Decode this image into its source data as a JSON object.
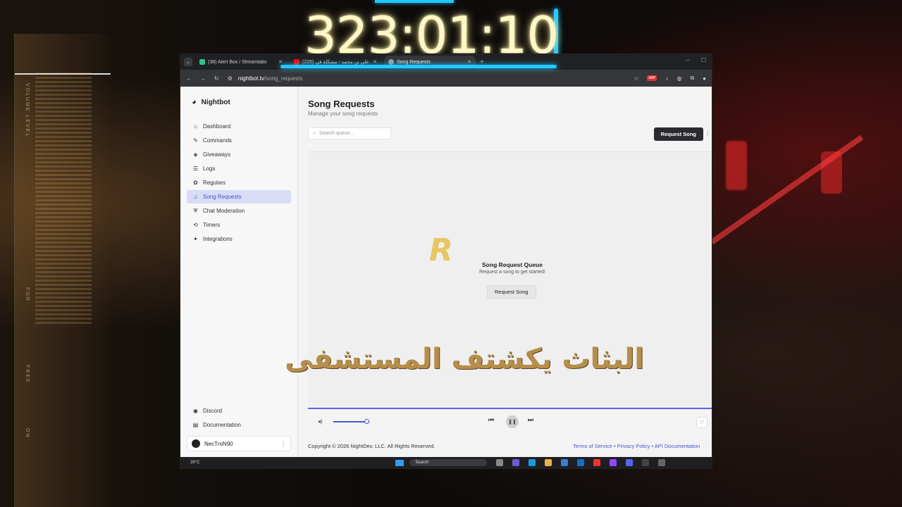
{
  "stream_overlay": {
    "timer": "323:01:10",
    "caption": "البثاث يكشتف المستشفى",
    "volume_label": "VOLUME LEVEL",
    "side_label_1": "FOR",
    "side_label_2": "FREE",
    "side_label_3": "ON",
    "accent_color": "#22c8ff"
  },
  "browser": {
    "tabs": [
      {
        "label": "(38) Alert Box / Streamlabs",
        "favicon_color": "#31c48d"
      },
      {
        "label": "(225) علي بن محمد - مشكلة في",
        "favicon_color": "#ff0000"
      },
      {
        "label": "Song Requests",
        "favicon_color": "#9aa0a6"
      }
    ],
    "active_tab": 2,
    "url_host": "nightbot.tv",
    "url_path": "/song_requests",
    "ext_badge": "ABP"
  },
  "sidebar": {
    "brand": "Nightbot",
    "items": [
      {
        "label": "Dashboard",
        "icon": "home-icon",
        "glyph": "⌂"
      },
      {
        "label": "Commands",
        "icon": "wand-icon",
        "glyph": "✎"
      },
      {
        "label": "Giveaways",
        "icon": "ticket-icon",
        "glyph": "◈"
      },
      {
        "label": "Logs",
        "icon": "list-icon",
        "glyph": "☰"
      },
      {
        "label": "Regulars",
        "icon": "users-icon",
        "glyph": "✿"
      },
      {
        "label": "Song Requests",
        "icon": "headphones-icon",
        "glyph": "♫"
      },
      {
        "label": "Chat Moderation",
        "icon": "shield-icon",
        "glyph": "⛨"
      },
      {
        "label": "Timers",
        "icon": "timer-icon",
        "glyph": "⟲"
      },
      {
        "label": "Integrations",
        "icon": "puzzle-icon",
        "glyph": "✦"
      }
    ],
    "active_item": 5,
    "bottom_links": [
      {
        "label": "Discord",
        "icon": "discord-icon",
        "glyph": "◉"
      },
      {
        "label": "Documentation",
        "icon": "book-icon",
        "glyph": "▤"
      }
    ],
    "user": {
      "name": "NecTroN90"
    }
  },
  "main": {
    "title": "Song Requests",
    "subtitle": "Manage your song requests",
    "search_placeholder": "Search queue...",
    "request_button": "Request Song",
    "empty_title": "Song Request Queue",
    "empty_subtitle": "Request a song to get started!",
    "empty_button": "Request Song",
    "logo_letter": "R"
  },
  "player": {
    "volume": 0.9,
    "accent": "#4a56d9"
  },
  "footer": {
    "copyright": "Copyright © 2026 NightDev, LLC. All Rights Reserved.",
    "links": "Terms of Service • Privacy Policy • API Documentation"
  },
  "taskbar": {
    "weather": "28°C",
    "search_label": "Search"
  }
}
